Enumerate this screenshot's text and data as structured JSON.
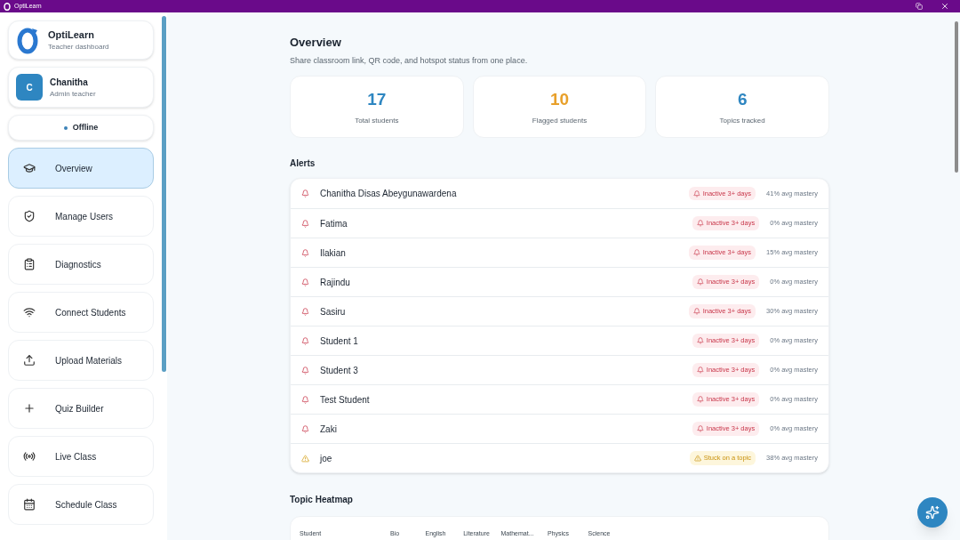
{
  "window": {
    "title": "OptiLearn"
  },
  "brand": {
    "name": "OptiLearn",
    "subtitle": "Teacher dashboard"
  },
  "user": {
    "initial": "C",
    "name": "Chanitha",
    "role": "Admin teacher"
  },
  "connection": {
    "label": "Offline",
    "online": false
  },
  "nav": [
    {
      "label": "Overview",
      "selected": true
    },
    {
      "label": "Manage Users",
      "selected": false
    },
    {
      "label": "Diagnostics",
      "selected": false
    },
    {
      "label": "Connect Students",
      "selected": false
    },
    {
      "label": "Upload Materials",
      "selected": false
    },
    {
      "label": "Quiz Builder",
      "selected": false
    },
    {
      "label": "Live Class",
      "selected": false
    },
    {
      "label": "Schedule Class",
      "selected": false
    }
  ],
  "page": {
    "title": "Overview",
    "subtitle": "Share classroom link, QR code, and hotspot status from one place."
  },
  "stats": [
    {
      "value": "17",
      "label": "Total students",
      "color": "#2e86c1"
    },
    {
      "value": "10",
      "label": "Flagged students",
      "color": "#e8a02a"
    },
    {
      "value": "6",
      "label": "Topics tracked",
      "color": "#2e86c1"
    }
  ],
  "alerts_title": "Alerts",
  "alerts": [
    {
      "name": "Chanitha Disas Abeygunawardena",
      "kind": "inactive",
      "badge": "Inactive 3+ days",
      "mastery": "41% avg mastery"
    },
    {
      "name": "Fatima",
      "kind": "inactive",
      "badge": "Inactive 3+ days",
      "mastery": "0% avg mastery"
    },
    {
      "name": "Ilakian",
      "kind": "inactive",
      "badge": "Inactive 3+ days",
      "mastery": "15% avg mastery"
    },
    {
      "name": "Rajindu",
      "kind": "inactive",
      "badge": "Inactive 3+ days",
      "mastery": "0% avg mastery"
    },
    {
      "name": "Sasiru",
      "kind": "inactive",
      "badge": "Inactive 3+ days",
      "mastery": "30% avg mastery"
    },
    {
      "name": "Student 1",
      "kind": "inactive",
      "badge": "Inactive 3+ days",
      "mastery": "0% avg mastery"
    },
    {
      "name": "Student 3",
      "kind": "inactive",
      "badge": "Inactive 3+ days",
      "mastery": "0% avg mastery"
    },
    {
      "name": "Test Student",
      "kind": "inactive",
      "badge": "Inactive 3+ days",
      "mastery": "0% avg mastery"
    },
    {
      "name": "Zaki",
      "kind": "inactive",
      "badge": "Inactive 3+ days",
      "mastery": "0% avg mastery"
    },
    {
      "name": "joe",
      "kind": "stuck",
      "badge": "Stuck on a topic",
      "mastery": "38% avg mastery"
    }
  ],
  "heatmap": {
    "title": "Topic Heatmap",
    "columns": [
      "Student",
      "Bio",
      "English",
      "Literature",
      "Mathemat...",
      "Physics",
      "Science"
    ]
  }
}
